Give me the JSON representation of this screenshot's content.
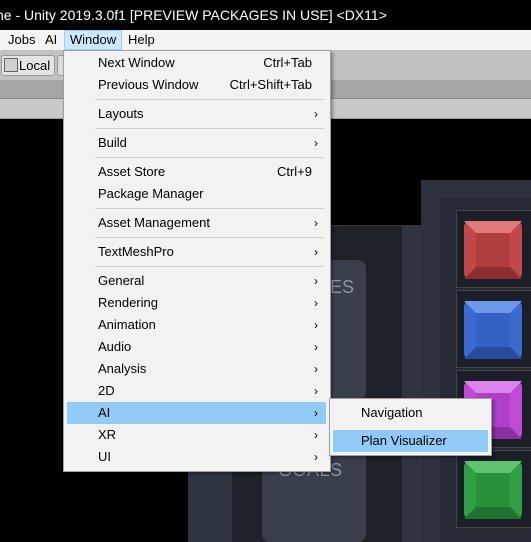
{
  "window": {
    "title": "ne - Unity 2019.3.0f1 [PREVIEW PACKAGES IN USE] <DX11>"
  },
  "menubar": {
    "items": [
      {
        "label": "Jobs"
      },
      {
        "label": "AI"
      },
      {
        "label": "Window",
        "active": true
      },
      {
        "label": "Help"
      }
    ]
  },
  "toolbar": {
    "local_label": "Local"
  },
  "window_menu": {
    "items": [
      {
        "label": "Next Window",
        "shortcut": "Ctrl+Tab"
      },
      {
        "label": "Previous Window",
        "shortcut": "Ctrl+Shift+Tab"
      },
      {
        "label": "Layouts",
        "submenu": true
      },
      {
        "label": "Build",
        "submenu": true
      },
      {
        "label": "Asset Store",
        "shortcut": "Ctrl+9"
      },
      {
        "label": "Package Manager"
      },
      {
        "label": "Asset Management",
        "submenu": true
      },
      {
        "label": "TextMeshPro",
        "submenu": true
      },
      {
        "label": "General",
        "submenu": true
      },
      {
        "label": "Rendering",
        "submenu": true
      },
      {
        "label": "Animation",
        "submenu": true
      },
      {
        "label": "Audio",
        "submenu": true
      },
      {
        "label": "Analysis",
        "submenu": true
      },
      {
        "label": "2D",
        "submenu": true
      },
      {
        "label": "AI",
        "submenu": true,
        "highlighted": true
      },
      {
        "label": "XR",
        "submenu": true
      },
      {
        "label": "UI",
        "submenu": true
      }
    ],
    "arrow_glyph": "›"
  },
  "ai_submenu": {
    "items": [
      {
        "label": "Navigation"
      },
      {
        "label": "Plan Visualizer",
        "highlighted": true
      }
    ]
  },
  "scene": {
    "goals_label": "GOALS",
    "partial_label": "ES",
    "cube_colors": [
      "#c2474a",
      "#3b6bd0",
      "#c04ad6",
      "#2f9e44"
    ]
  },
  "colors": {
    "menu_highlight": "#91c9f7",
    "menubar_active": "#cce8ff"
  }
}
